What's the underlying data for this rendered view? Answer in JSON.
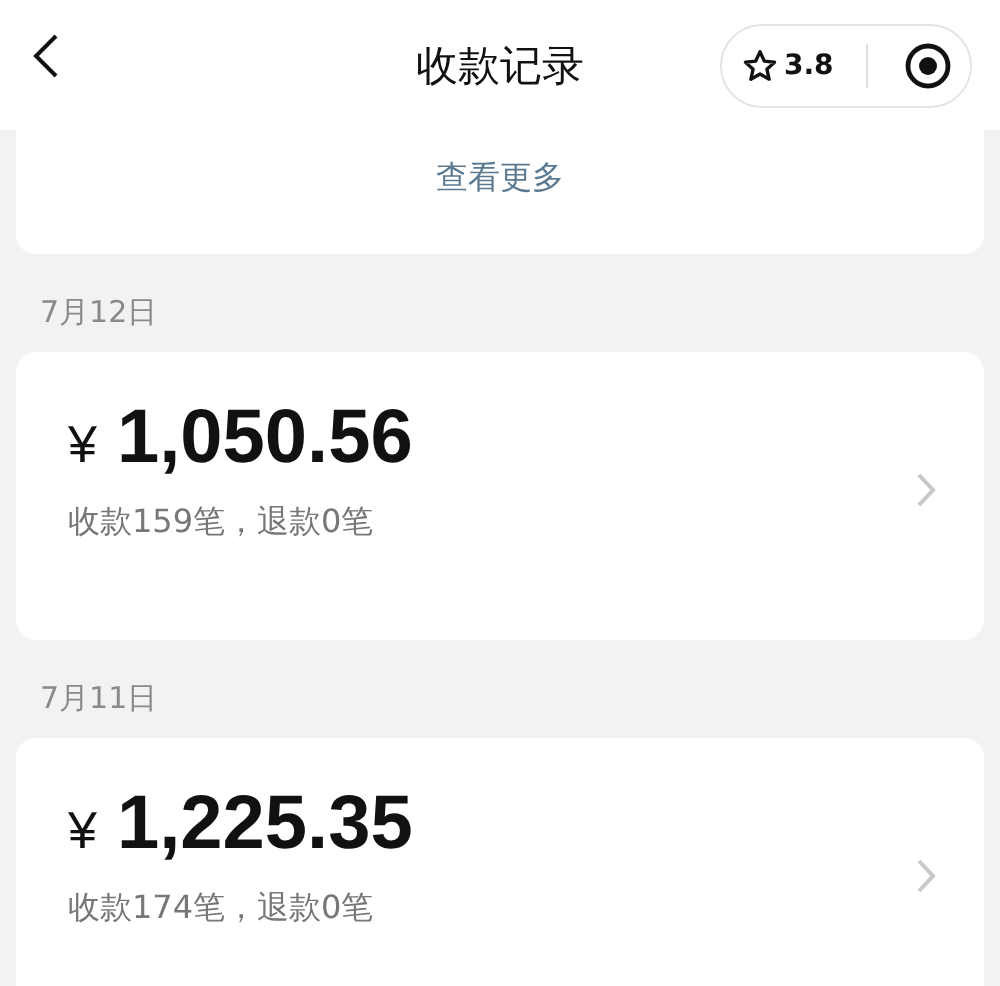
{
  "header": {
    "title": "收款记录",
    "rating": "3.8"
  },
  "more_link": "查看更多",
  "days": [
    {
      "date": "7月12日",
      "currency": "¥",
      "amount": "1,050.56",
      "summary": "收款159笔，退款0笔"
    },
    {
      "date": "7月11日",
      "currency": "¥",
      "amount": "1,225.35",
      "summary": "收款174笔，退款0笔"
    }
  ]
}
